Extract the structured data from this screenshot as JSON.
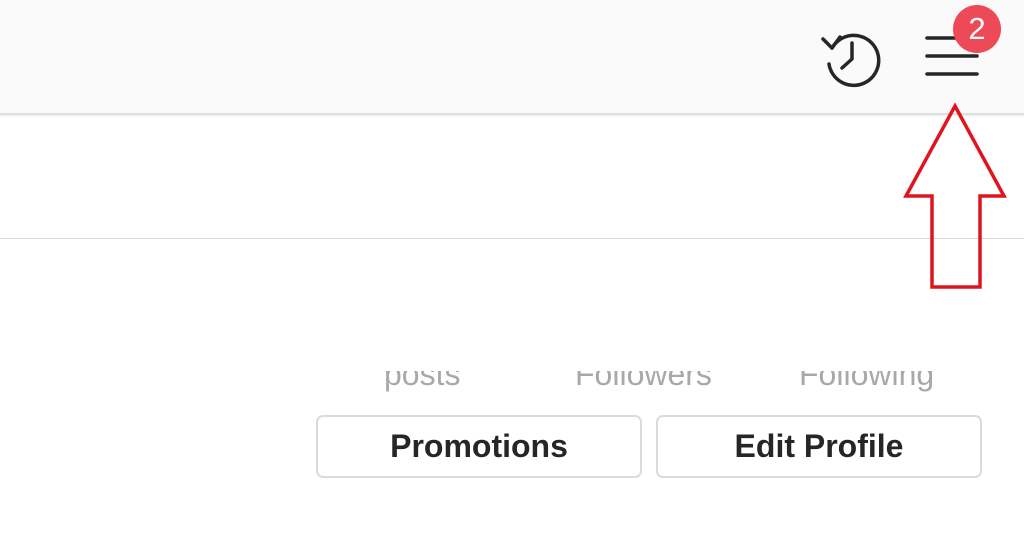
{
  "header": {
    "history_icon": "history-icon",
    "menu_icon": "menu-icon",
    "notification_count": "2"
  },
  "profile": {
    "stats": [
      {
        "label": "posts"
      },
      {
        "label": "Followers"
      },
      {
        "label": "Following"
      }
    ],
    "buttons": {
      "promotions_label": "Promotions",
      "edit_profile_label": "Edit Profile"
    }
  },
  "colors": {
    "badge": "#ed4956",
    "annotation_arrow": "#e0141e",
    "text_primary": "#262626",
    "text_muted": "#a8a8a8",
    "border": "#dbdbdb",
    "topbar_bg": "#fafafa"
  },
  "annotation": {
    "shape": "up-arrow"
  }
}
